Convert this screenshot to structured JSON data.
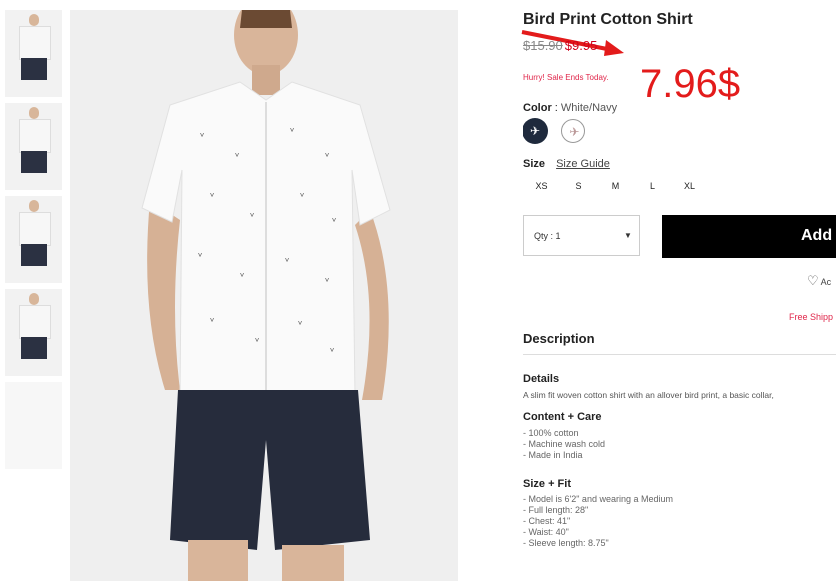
{
  "gallery": {
    "thumbnails": [
      "front",
      "side",
      "front",
      "full",
      "detail"
    ]
  },
  "product": {
    "title": "Bird Print Cotton Shirt",
    "old_price": "$15.90",
    "sale_price": "$9.95",
    "sale_notice": "Hurry! Sale Ends Today.",
    "color_label": "Color",
    "color_value": "White/Navy",
    "swatches": [
      "navy",
      "white"
    ],
    "size_label": "Size",
    "size_guide": "Size Guide",
    "sizes": [
      "XS",
      "S",
      "M",
      "L",
      "XL"
    ],
    "qty_label": "Qty : 1",
    "add_button": "Add",
    "wishlist_label": "Ac",
    "shipping_note": "Free Shipp",
    "description_heading": "Description",
    "details_heading": "Details",
    "details_text": "A slim fit woven cotton shirt with an allover bird print, a basic collar,",
    "care_heading": "Content + Care",
    "care_items": [
      "- 100% cotton",
      "- Machine wash cold",
      "- Made in India"
    ],
    "fit_heading": "Size + Fit",
    "fit_items": [
      "- Model is 6'2\" and wearing a Medium",
      "- Full length: 28\"",
      "- Chest: 41\"",
      "- Waist: 40\"",
      "- Sleeve length: 8.75\""
    ]
  },
  "annotation": {
    "text": "7.96$",
    "color": "#e31b1b"
  },
  "colors": {
    "sale_red": "#d0021b",
    "notice_pink": "#e0264a",
    "button_black": "#000000"
  }
}
